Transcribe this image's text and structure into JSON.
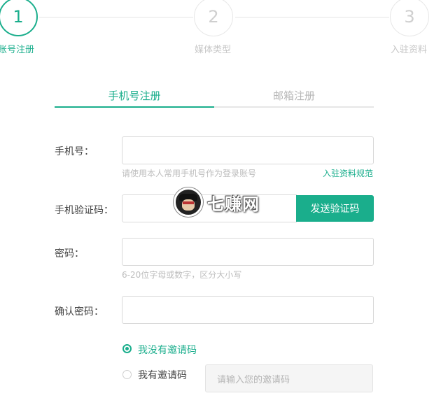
{
  "steps": [
    {
      "number": "1",
      "label": "账号注册",
      "active": true
    },
    {
      "number": "2",
      "label": "媒体类型",
      "active": false
    },
    {
      "number": "3",
      "label": "入驻资料",
      "active": false
    }
  ],
  "tabs": {
    "phone": "手机号注册",
    "email": "邮箱注册"
  },
  "form": {
    "phone_label": "手机号：",
    "phone_value": "",
    "phone_hint": "请使用本人常用手机号作为登录账号",
    "rules_link": "入驻资料规范",
    "code_label": "手机验证码：",
    "code_value": "",
    "send_code_button": "发送验证码",
    "password_label": "密码：",
    "password_value": "",
    "password_hint": "6-20位字母或数字，区分大小写",
    "confirm_label": "确认密码：",
    "confirm_value": ""
  },
  "invite": {
    "option_no": "我没有邀请码",
    "option_yes": "我有邀请码",
    "selected": "no",
    "placeholder": "请输入您的邀请码"
  },
  "watermark": {
    "text": "七赚网"
  },
  "colors": {
    "accent": "#1aae8c",
    "muted": "#bdbdbd",
    "border": "#d9d9d9"
  }
}
